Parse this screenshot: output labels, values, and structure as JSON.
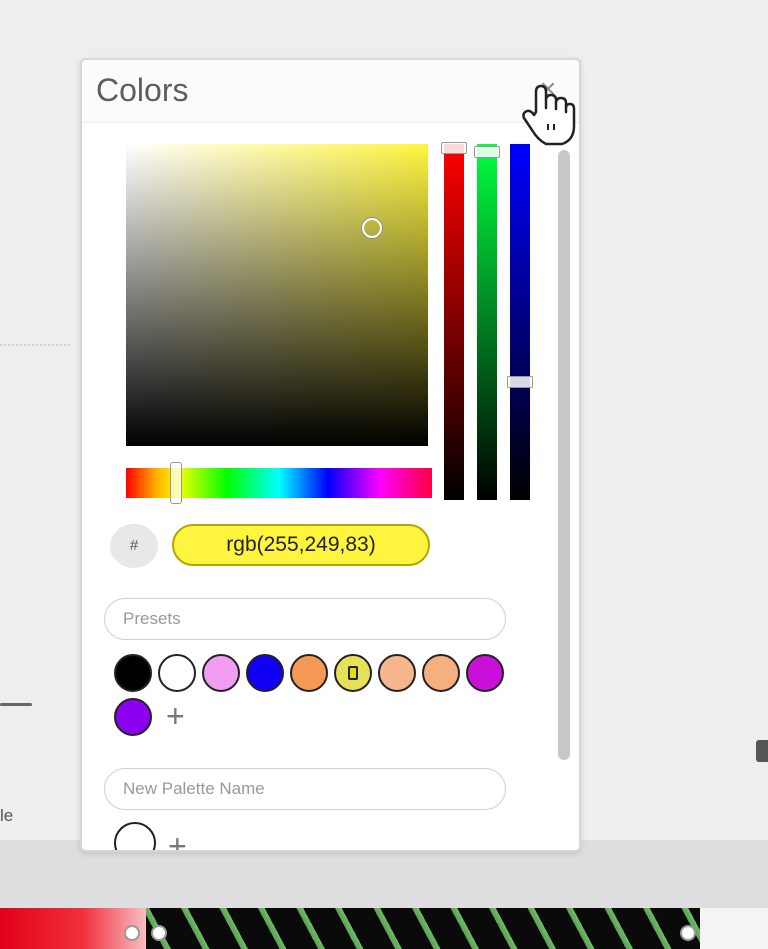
{
  "panel": {
    "title": "Colors",
    "close_icon": "close-icon",
    "color_value": "rgb(255,249,83)",
    "hash_label": "#",
    "presets_placeholder": "Presets",
    "new_palette_placeholder": "New Palette Name",
    "add_label": "+",
    "current_color": "#fff53f",
    "preset_colors": [
      "#000000",
      "#ffffff",
      "#f29cf2",
      "#1200f5",
      "#f59a56",
      "#e6e05a",
      "#f6b58c",
      "#f5b07d",
      "#c810d8",
      "#8c00f0"
    ],
    "selected_preset_index": 5
  },
  "background": {
    "cut_text": "le",
    "cursor": "hand-pointer-icon"
  }
}
